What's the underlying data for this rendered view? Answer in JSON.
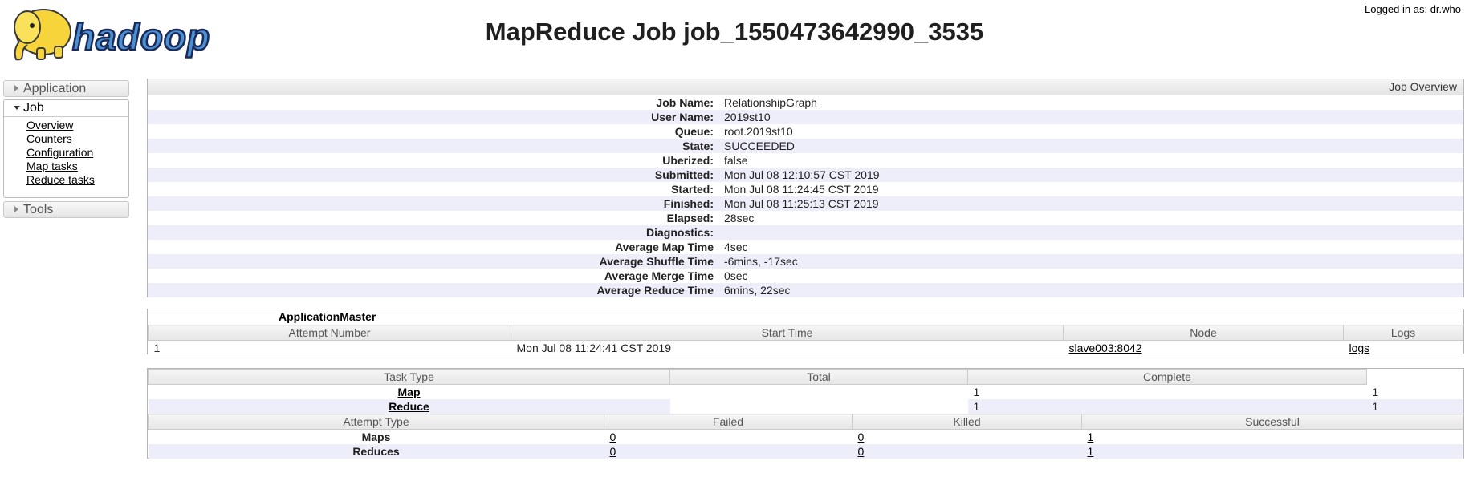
{
  "header": {
    "logo_text": "hadoop",
    "title": "MapReduce Job job_1550473642990_3535",
    "user_info": "Logged in as: dr.who"
  },
  "nav": {
    "application_label": "Application",
    "job_label": "Job",
    "job_links": [
      "Overview",
      "Counters",
      "Configuration",
      "Map tasks",
      "Reduce tasks"
    ],
    "tools_label": "Tools"
  },
  "overview": {
    "header": "Job Overview",
    "rows": [
      {
        "label": "Job Name:",
        "value": "RelationshipGraph"
      },
      {
        "label": "User Name:",
        "value": "2019st10"
      },
      {
        "label": "Queue:",
        "value": "root.2019st10"
      },
      {
        "label": "State:",
        "value": "SUCCEEDED"
      },
      {
        "label": "Uberized:",
        "value": "false"
      },
      {
        "label": "Submitted:",
        "value": "Mon Jul 08 12:10:57 CST 2019"
      },
      {
        "label": "Started:",
        "value": "Mon Jul 08 11:24:45 CST 2019"
      },
      {
        "label": "Finished:",
        "value": "Mon Jul 08 11:25:13 CST 2019"
      },
      {
        "label": "Elapsed:",
        "value": "28sec"
      },
      {
        "label": "Diagnostics:",
        "value": ""
      },
      {
        "label": "Average Map Time",
        "value": "4sec"
      },
      {
        "label": "Average Shuffle Time",
        "value": "-6mins, -17sec"
      },
      {
        "label": "Average Merge Time",
        "value": "0sec"
      },
      {
        "label": "Average Reduce Time",
        "value": "6mins, 22sec"
      }
    ]
  },
  "am": {
    "title": "ApplicationMaster",
    "headers": [
      "Attempt Number",
      "Start Time",
      "Node",
      "Logs"
    ],
    "row": {
      "attempt": "1",
      "start_time": "Mon Jul 08 11:24:41 CST 2019",
      "node": "slave003:8042",
      "logs": "logs"
    }
  },
  "tasks": {
    "headers": [
      "Task Type",
      "Total",
      "Complete"
    ],
    "rows": [
      {
        "type": "Map",
        "total": "1",
        "complete": "1"
      },
      {
        "type": "Reduce",
        "total": "1",
        "complete": "1"
      }
    ],
    "attempt_headers": [
      "Attempt Type",
      "Failed",
      "Killed",
      "Successful"
    ],
    "attempt_rows": [
      {
        "type": "Maps",
        "failed": "0",
        "killed": "0",
        "successful": "1"
      },
      {
        "type": "Reduces",
        "failed": "0",
        "killed": "0",
        "successful": "1"
      }
    ]
  }
}
